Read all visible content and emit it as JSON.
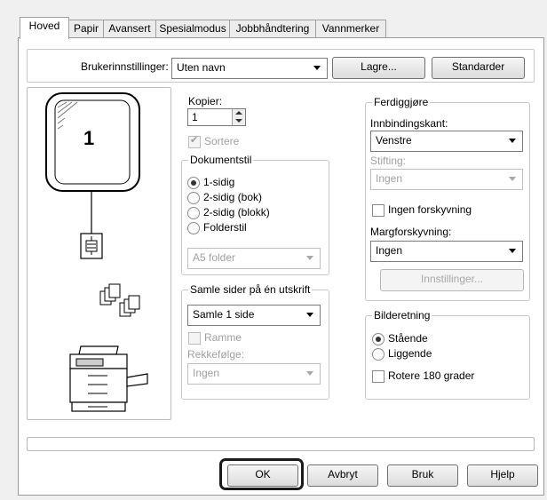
{
  "tabs": [
    {
      "label": "Hoved",
      "active": true
    },
    {
      "label": "Papir"
    },
    {
      "label": "Avansert"
    },
    {
      "label": "Spesialmodus"
    },
    {
      "label": "Jobbhåndtering"
    },
    {
      "label": "Vannmerker"
    }
  ],
  "user_settings": {
    "label": "Brukerinnstillinger:",
    "value": "Uten navn",
    "save": "Lagre...",
    "defaults": "Standarder"
  },
  "preview": {
    "page_number": "1"
  },
  "copies": {
    "label": "Kopier:",
    "value": "1",
    "collate": "Sortere",
    "collate_checked": true
  },
  "document_style": {
    "title": "Dokumentstil",
    "options": [
      "1-sidig",
      "2-sidig (bok)",
      "2-sidig (blokk)",
      "Folderstil"
    ],
    "selected": "1-sidig",
    "folder_value": "A5 folder"
  },
  "nup": {
    "title": "Samle sider på én utskrift",
    "value": "Samle 1 side",
    "border": "Ramme",
    "order_label": "Rekkefølge:",
    "order_value": "Ingen"
  },
  "finishing": {
    "title": "Ferdiggjøre",
    "binding_label": "Innbindingskant:",
    "binding_value": "Venstre",
    "staple_label": "Stifting:",
    "staple_value": "Ingen",
    "no_offset": "Ingen forskyvning",
    "margin_label": "Margforskyvning:",
    "margin_value": "Ingen",
    "settings_btn": "Innstillinger..."
  },
  "orientation": {
    "title": "Bilderetning",
    "options": [
      "Stående",
      "Liggende"
    ],
    "selected": "Stående",
    "rotate": "Rotere 180 grader"
  },
  "buttons": {
    "ok": "OK",
    "cancel": "Avbryt",
    "apply": "Bruk",
    "help": "Hjelp"
  },
  "colors": {
    "highlight": "#1a1a1a"
  }
}
